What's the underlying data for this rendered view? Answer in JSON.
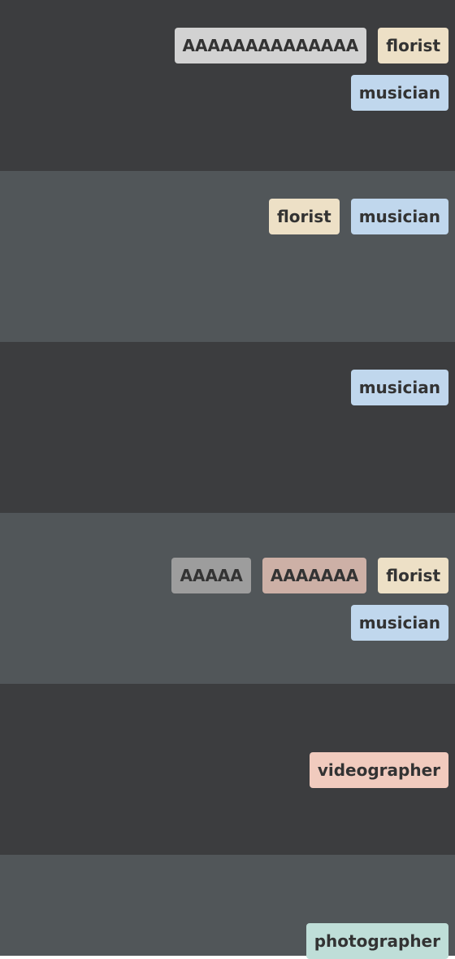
{
  "rows": [
    {
      "tags": [
        {
          "label": "AAAAAAAAAAAAAA",
          "color": "#d2d2d2"
        },
        {
          "label": "florist",
          "color": "#ede0c6"
        },
        {
          "label": "musician",
          "color": "#c0d7ed"
        }
      ]
    },
    {
      "tags": [
        {
          "label": "florist",
          "color": "#ede0c6"
        },
        {
          "label": "musician",
          "color": "#c0d7ed"
        }
      ]
    },
    {
      "tags": [
        {
          "label": "musician",
          "color": "#c0d7ed"
        }
      ]
    },
    {
      "tags": [
        {
          "label": "AAAAA",
          "color": "#9d9d9d"
        },
        {
          "label": "AAAAAAA",
          "color": "#cdb0a6"
        },
        {
          "label": "florist",
          "color": "#ede0c6"
        },
        {
          "label": "musician",
          "color": "#c0d7ed"
        }
      ]
    },
    {
      "tags": [
        {
          "label": "videographer",
          "color": "#f1cbbe"
        }
      ]
    },
    {
      "tags": [
        {
          "label": "photographer",
          "color": "#bfded8"
        }
      ]
    }
  ],
  "colors": {
    "band_dark": "#3c3d3f",
    "band_light": "#515659",
    "tag_text": "#333333"
  }
}
